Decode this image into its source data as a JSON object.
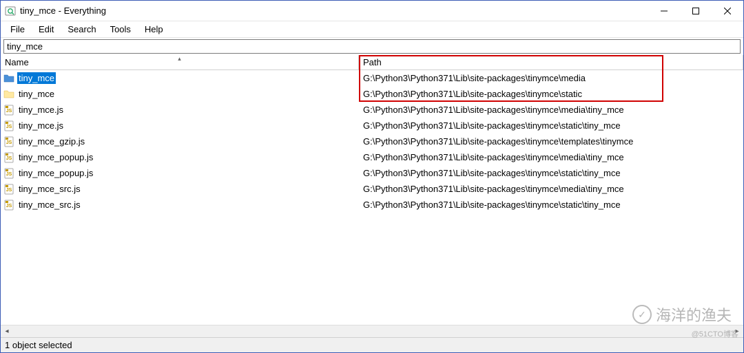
{
  "window": {
    "title": "tiny_mce - Everything"
  },
  "menu": {
    "file": "File",
    "edit": "Edit",
    "search": "Search",
    "tools": "Tools",
    "help": "Help"
  },
  "search": {
    "value": "tiny_mce"
  },
  "columns": {
    "name": "Name",
    "path": "Path"
  },
  "results": [
    {
      "icon": "folder-blue",
      "name": "tiny_mce",
      "path": "G:\\Python3\\Python371\\Lib\\site-packages\\tinymce\\media",
      "selected": true
    },
    {
      "icon": "folder",
      "name": "tiny_mce",
      "path": "G:\\Python3\\Python371\\Lib\\site-packages\\tinymce\\static",
      "selected": false
    },
    {
      "icon": "js",
      "name": "tiny_mce.js",
      "path": "G:\\Python3\\Python371\\Lib\\site-packages\\tinymce\\media\\tiny_mce",
      "selected": false
    },
    {
      "icon": "js",
      "name": "tiny_mce.js",
      "path": "G:\\Python3\\Python371\\Lib\\site-packages\\tinymce\\static\\tiny_mce",
      "selected": false
    },
    {
      "icon": "js",
      "name": "tiny_mce_gzip.js",
      "path": "G:\\Python3\\Python371\\Lib\\site-packages\\tinymce\\templates\\tinymce",
      "selected": false
    },
    {
      "icon": "js",
      "name": "tiny_mce_popup.js",
      "path": "G:\\Python3\\Python371\\Lib\\site-packages\\tinymce\\media\\tiny_mce",
      "selected": false
    },
    {
      "icon": "js",
      "name": "tiny_mce_popup.js",
      "path": "G:\\Python3\\Python371\\Lib\\site-packages\\tinymce\\static\\tiny_mce",
      "selected": false
    },
    {
      "icon": "js",
      "name": "tiny_mce_src.js",
      "path": "G:\\Python3\\Python371\\Lib\\site-packages\\tinymce\\media\\tiny_mce",
      "selected": false
    },
    {
      "icon": "js",
      "name": "tiny_mce_src.js",
      "path": "G:\\Python3\\Python371\\Lib\\site-packages\\tinymce\\static\\tiny_mce",
      "selected": false
    }
  ],
  "status": {
    "text": "1 object selected"
  },
  "watermarks": {
    "main": "海洋的渔夫",
    "sub": "@51CTO博客"
  }
}
